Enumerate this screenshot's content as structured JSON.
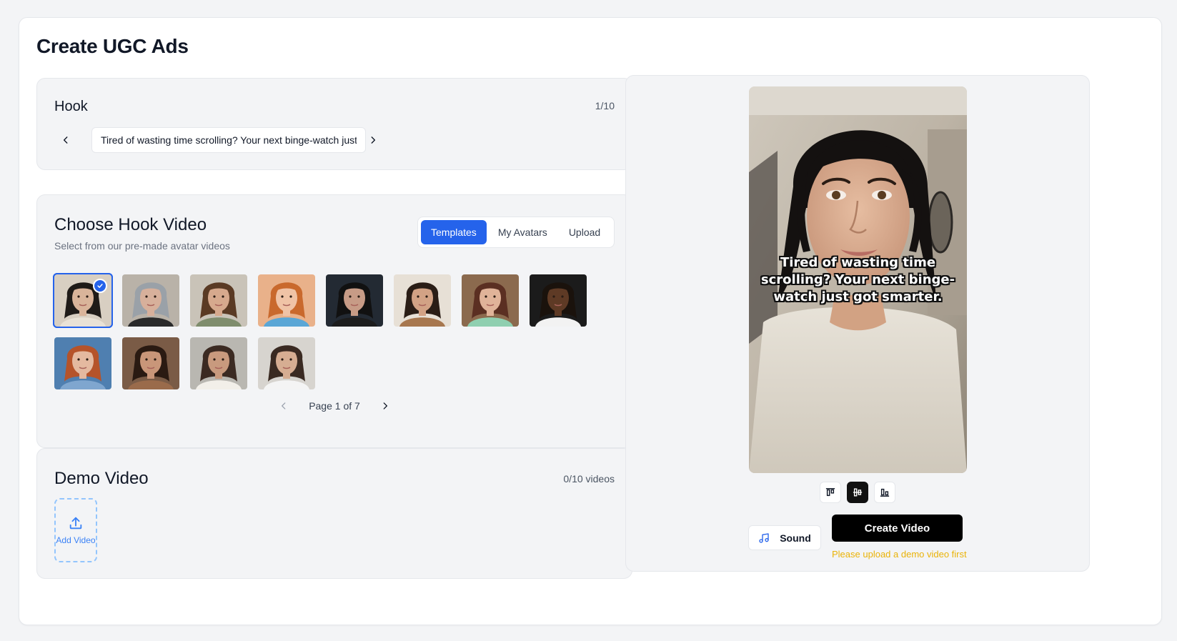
{
  "page": {
    "title": "Create UGC Ads"
  },
  "hook": {
    "title": "Hook",
    "counter": "1/10",
    "text": "Tired of wasting time scrolling? Your next binge-watch just got smarter."
  },
  "hook_video": {
    "title": "Choose Hook Video",
    "subtitle": "Select from our pre-made avatar videos",
    "tabs": [
      "Templates",
      "My Avatars",
      "Upload"
    ],
    "active_tab": "Templates",
    "thumbnails": [
      {
        "skin": "#d9b49a",
        "hair": "#1f1b18",
        "bg": "#d8cfc2",
        "shirt": "#e9e2d6",
        "selected": true
      },
      {
        "skin": "#d7b09b",
        "hair": "#9aa1a8",
        "bg": "#b9b2a8",
        "shirt": "#2a2a2a",
        "selected": false
      },
      {
        "skin": "#d6a98d",
        "hair": "#5a3a24",
        "bg": "#c9c3b8",
        "shirt": "#7f8d6d",
        "selected": false
      },
      {
        "skin": "#f0c3a6",
        "hair": "#c9692d",
        "bg": "#e9b18a",
        "shirt": "#5aa6d6",
        "selected": false
      },
      {
        "skin": "#c79b86",
        "hair": "#111111",
        "bg": "#232a33",
        "shirt": "#1d1d1d",
        "selected": false
      },
      {
        "skin": "#d2a285",
        "hair": "#2a1d16",
        "bg": "#e7e0d6",
        "shirt": "#a7774f",
        "selected": false
      },
      {
        "skin": "#e0b399",
        "hair": "#5b2f22",
        "bg": "#8b6a4e",
        "shirt": "#8fcfb0",
        "selected": false
      },
      {
        "skin": "#5e3a25",
        "hair": "#1a120c",
        "bg": "#1b1b1b",
        "shirt": "#f2f2f2",
        "selected": false
      },
      {
        "skin": "#e4b9a0",
        "hair": "#b5532a",
        "bg": "#4f7fb0",
        "shirt": "#7fa6cf",
        "selected": false
      },
      {
        "skin": "#c99679",
        "hair": "#2a1a12",
        "bg": "#7a5b46",
        "shirt": "#9a6b4b",
        "selected": false
      },
      {
        "skin": "#c89a7e",
        "hair": "#3b2a22",
        "bg": "#b9b7b1",
        "shirt": "#f2efe9",
        "selected": false
      },
      {
        "skin": "#d6ad92",
        "hair": "#3a2a22",
        "bg": "#d7d4cf",
        "shirt": "#f4f4f4",
        "selected": false
      }
    ],
    "pager": "Page 1 of 7"
  },
  "demo": {
    "title": "Demo Video",
    "counter": "0/10 videos",
    "add_label": "Add Video"
  },
  "preview": {
    "caption": "Tired of wasting time scrolling? Your next binge-watch just got smarter.",
    "caption_position": "middle",
    "sound_label": "Sound",
    "create_label": "Create Video",
    "warning": "Please upload a demo video first"
  },
  "colors": {
    "accent": "#2563eb",
    "warning": "#eab308"
  }
}
